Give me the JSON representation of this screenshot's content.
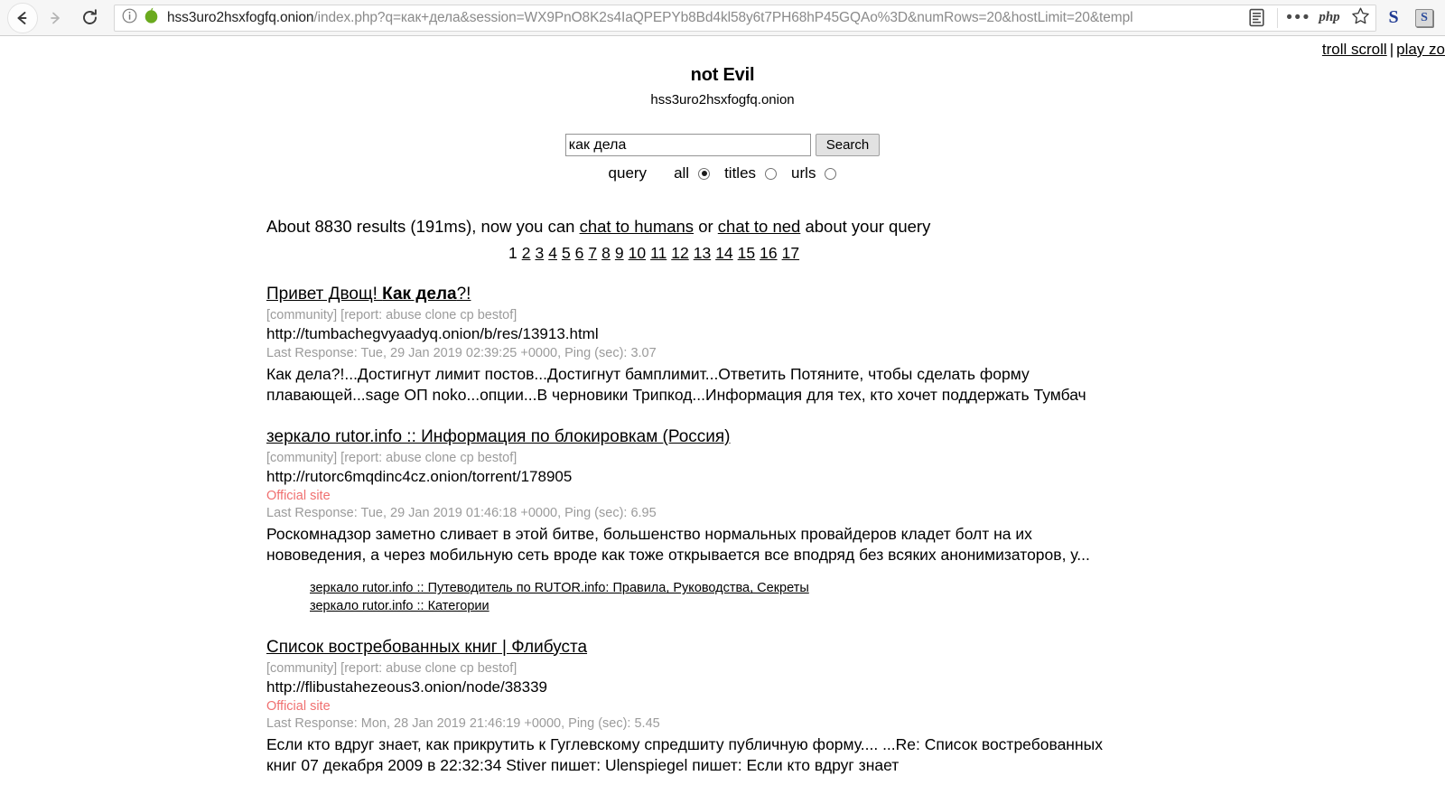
{
  "browser": {
    "back_icon": "back-arrow-icon",
    "forward_icon": "forward-arrow-icon",
    "reload_icon": "reload-icon",
    "info_icon": "info-circle-icon",
    "onion_icon": "tor-onion-icon",
    "url_host": "hss3uro2hsxfogfq.onion",
    "url_path": "/index.php?q=как+дела&session=WX9PnO8K2s4IaQPEPYb8Bd4kl58y6t7PH68hP45GQAo%3D&numRows=20&hostLimit=20&templ",
    "reader_icon": "reader-view-icon",
    "menu_dots": "•••",
    "php_label": "php",
    "bookmark_icon": "star-bookmark-icon",
    "ext1_label": "S",
    "ext2_label": "S"
  },
  "header": {
    "troll_scroll": "troll scroll",
    "separator": "|",
    "play_zone": "play zo",
    "site_title": "not Evil",
    "site_domain": "hss3uro2hsxfogfq.onion"
  },
  "search": {
    "query_value": "как дела",
    "placeholder": "",
    "button_label": "Search",
    "scope_label": "query",
    "options": [
      {
        "label": "all",
        "checked": true
      },
      {
        "label": "titles",
        "checked": false
      },
      {
        "label": "urls",
        "checked": false
      }
    ]
  },
  "results_meta": {
    "prefix": "About 8830 results (191ms), now you can ",
    "link_humans": "chat to humans",
    "middle": " or ",
    "link_ned": "chat to ned",
    "suffix": " about your query",
    "count": "8830",
    "time_ms": "191ms"
  },
  "pagination": {
    "current": "1",
    "pages": [
      "2",
      "3",
      "4",
      "5",
      "6",
      "7",
      "8",
      "9",
      "10",
      "11",
      "12",
      "13",
      "14",
      "15",
      "16",
      "17"
    ]
  },
  "results": [
    {
      "title_plain": "Привет Двощ! ",
      "title_bold": "Как дела",
      "title_tail": "?!",
      "tags": "[community] [report: abuse clone cp bestof]",
      "url": "http://tumbachegvyaadyq.onion/b/res/13913.html",
      "official": "",
      "response": "Last Response: Tue, 29 Jan 2019 02:39:25 +0000, Ping (sec): 3.07",
      "snippet": "Как дела?!...Достигнут лимит постов...Достигнут бамплимит...Ответить Потяните, чтобы сделать форму плавающей...sage ОП noko...опции...В черновики Трипкод...Информация для тех, кто хочет поддержать Тумбач",
      "sublinks": []
    },
    {
      "title_plain": "зеркало rutor.info :: Информация по блокировкам (Россия)",
      "title_bold": "",
      "title_tail": "",
      "tags": "[community] [report: abuse clone cp bestof]",
      "url": "http://rutorc6mqdinc4cz.onion/torrent/178905",
      "official": "Official site",
      "response": "Last Response: Tue, 29 Jan 2019 01:46:18 +0000, Ping (sec): 6.95",
      "snippet": "Роскомнадзор заметно сливает в этой битве, большенство нормальных провайдеров кладет болт на их нововедения, а через мобильную сеть вроде как тоже открывается все вподряд без всяких анонимизаторов, у...",
      "sublinks": [
        "зеркало rutor.info :: Путеводитель по RUTOR.info: Правила, Руководства, Секреты",
        "зеркало rutor.info :: Категории"
      ]
    },
    {
      "title_plain": "Список востребованных книг | Флибуста",
      "title_bold": "",
      "title_tail": "",
      "tags": "[community] [report: abuse clone cp bestof]",
      "url": "http://flibustahezeous3.onion/node/38339",
      "official": "Official site",
      "response": "Last Response: Mon, 28 Jan 2019 21:46:19 +0000, Ping (sec): 5.45",
      "snippet": "Если кто вдруг знает, как прикрутить к Гуглевскому спредшиту публичную форму.... ...Re: Список востребованных книг  07 декабря 2009  в 22:32:34 Stiver пишет:   Ulenspiegel пишет:   Если кто вдруг знает",
      "sublinks": []
    }
  ],
  "colors": {
    "official_site": "#f07070",
    "muted_text": "#9b9b9b",
    "onion_green": "#6aaa1e"
  }
}
